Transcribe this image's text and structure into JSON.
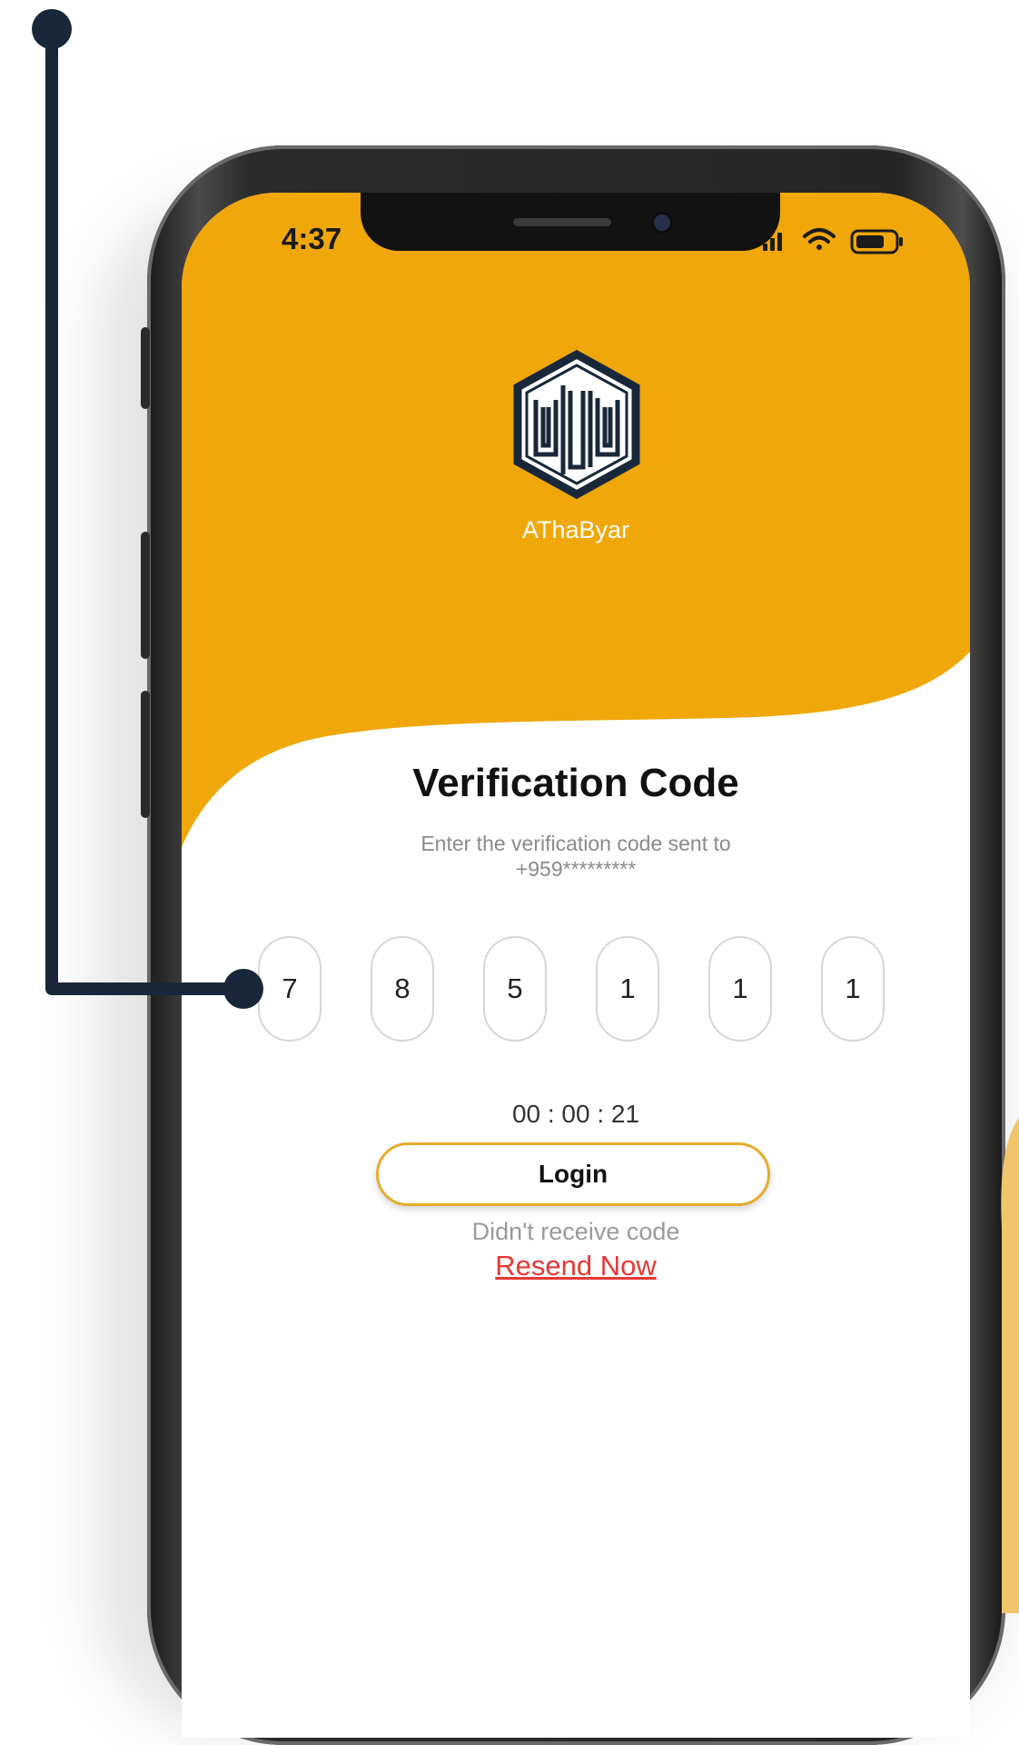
{
  "status_bar": {
    "time": "4:37"
  },
  "app": {
    "name": "AThaByar"
  },
  "verification": {
    "title": "Verification Code",
    "subtitle_line1": "Enter the verification code sent to",
    "subtitle_line2": "+959*********",
    "digits": [
      "7",
      "8",
      "5",
      "1",
      "1",
      "1"
    ],
    "timer": "00 : 00 : 21",
    "login_label": "Login",
    "no_code_text": "Didn't receive code",
    "resend_label": "Resend Now"
  },
  "colors": {
    "brand_orange": "#f0a70a",
    "resend_red": "#e53935",
    "button_border": "#e5ac2c",
    "callout_navy": "#18283a"
  },
  "icons": [
    "signal-icon",
    "wifi-icon",
    "battery-icon",
    "app-logo"
  ]
}
